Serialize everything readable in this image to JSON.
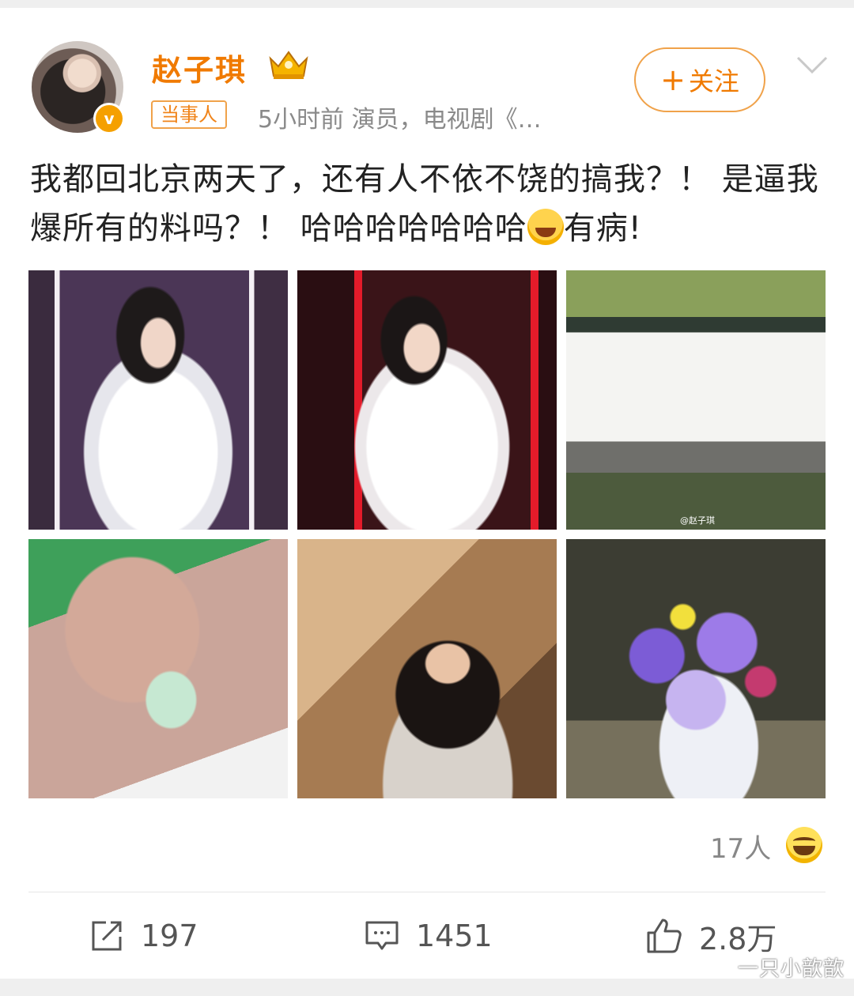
{
  "post": {
    "author": "赵子琪",
    "tag": "当事人",
    "meta": "5小时前  演员，电视剧《…",
    "follow_label": "关注",
    "text_part1": "我都回北京两天了，还有人不依不饶的搞我？！ 是逼我爆所有的料吗？！ 哈哈哈哈哈哈哈",
    "text_part2": "有病!",
    "photo_watermark": "@赵子琪",
    "reactions": "17人"
  },
  "actions": {
    "repost": "197",
    "comments": "1451",
    "likes": "2.8万"
  },
  "watermark": "一只小歆歆",
  "colors": {
    "accent": "#f07a00",
    "verified_badge": "#f5a000"
  },
  "icons": [
    "crown-icon",
    "chevron-down-icon",
    "laugh-cry-emoji",
    "grin-icon",
    "repost-icon",
    "comment-icon",
    "like-icon"
  ]
}
